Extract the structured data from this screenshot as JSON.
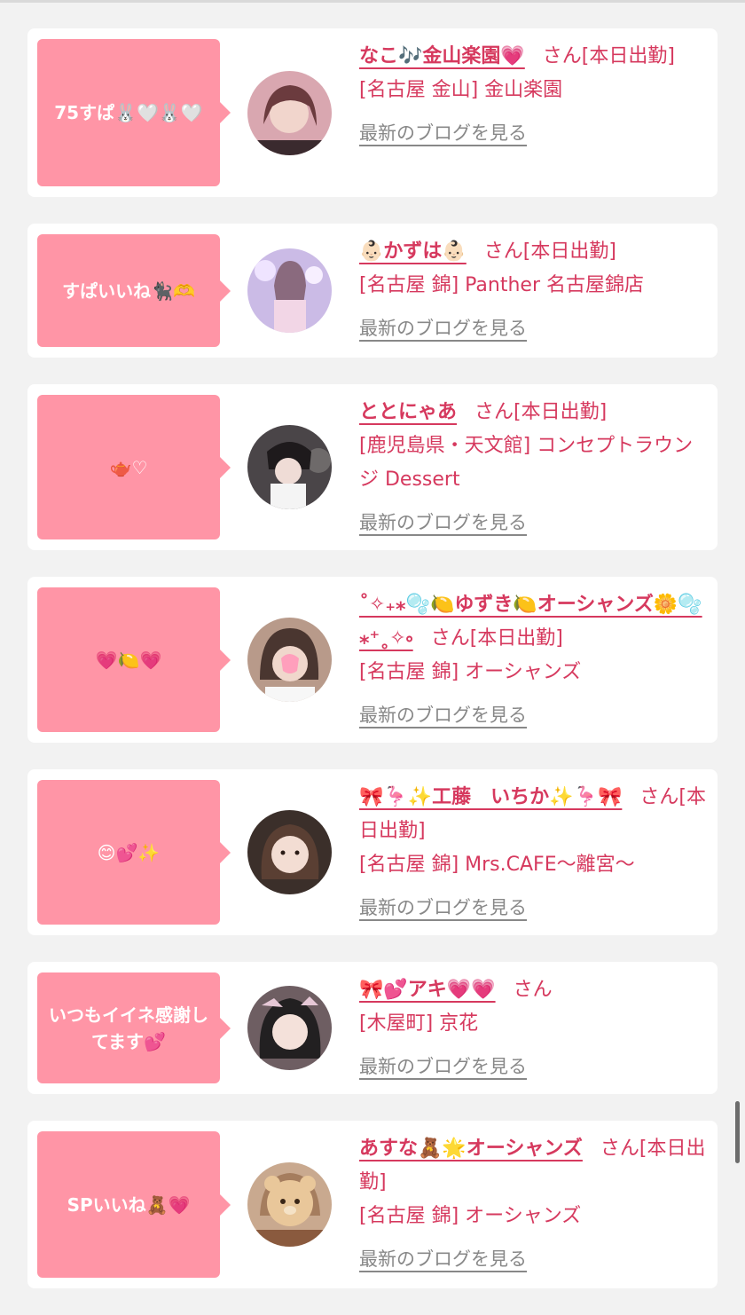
{
  "colors": {
    "accent": "#d6395e",
    "bubble": "#ff95a6",
    "background": "#f2f2f2"
  },
  "cards": [
    {
      "bubble": "75すぱ🐰🤍🐰🤍",
      "name": "なこ🎶金山楽園💗",
      "san": "さん[本日出勤]",
      "shop": "[名古屋 金山] 金山楽園",
      "blog": "最新のブログを見る",
      "avatar_icon": "girl-photo-avatar"
    },
    {
      "bubble": "すぱいいね🐈‍⬛🫶",
      "name": "👶🏻かずは👶🏻",
      "san": "さん[本日出勤]",
      "shop": "[名古屋 錦] Panther 名古屋錦店",
      "blog": "最新のブログを見る",
      "avatar_icon": "girl-photo-avatar"
    },
    {
      "bubble": "🫖♡",
      "name": "ととにゃあ",
      "san": "さん[本日出勤]",
      "shop": "[鹿児島県・天文館] コンセプトラウンジ Dessert",
      "blog": "最新のブログを見る",
      "avatar_icon": "girl-photo-avatar"
    },
    {
      "bubble": "💗🍋💗",
      "name": "˚✧₊⁎🫧🍋ゆずき🍋オーシャンズ🌼🫧⁎⁺˳✧༚",
      "san": "さん[本日出勤]",
      "shop": "[名古屋 錦] オーシャンズ",
      "blog": "最新のブログを見る",
      "avatar_icon": "girl-photo-avatar"
    },
    {
      "bubble": "😊💕✨",
      "name": "🎀🦩✨工藤　いちか✨🦩🎀",
      "san": "さん[本日出勤]",
      "shop": "[名古屋 錦] Mrs.CAFE〜離宮〜",
      "blog": "最新のブログを見る",
      "avatar_icon": "girl-photo-avatar"
    },
    {
      "bubble": "いつもイイネ感謝してます💕",
      "name": "🎀💕アキ💗💗",
      "san": "さん",
      "shop": "[木屋町] 京花",
      "blog": "最新のブログを見る",
      "avatar_icon": "girl-photo-avatar"
    },
    {
      "bubble": "SPいいね🧸💗",
      "name": "あすな🧸🌟オーシャンズ",
      "san": "さん[本日出勤]",
      "shop": "[名古屋 錦] オーシャンズ",
      "blog": "最新のブログを見る",
      "avatar_icon": "girl-photo-avatar"
    }
  ]
}
